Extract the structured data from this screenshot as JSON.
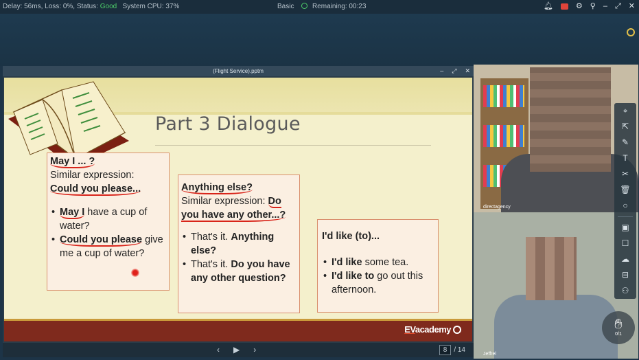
{
  "topbar": {
    "stats_prefix": "Delay: 56ms, Loss: 0%, Status:",
    "status": "Good",
    "cpu": "System CPU: 37%",
    "mode": "Basic",
    "remaining": "Remaining: 00:23"
  },
  "window": {
    "title": "(Flight Service).pptm"
  },
  "slide": {
    "title": "Part 3 Dialogue",
    "box1": {
      "heading": "May I ... ?",
      "similar": "Similar expression:",
      "expression": "Could you please...",
      "bullet1_bold": "May I",
      "bullet1_rest": " have a cup of water?",
      "bullet2_bold": "Could you please",
      "bullet2_rest": " give me a cup of water?"
    },
    "box2": {
      "heading": "Anything else?",
      "similar": "Similar expression: ",
      "expression": "Do you have any other...?",
      "bullet1_plain": "That's it. ",
      "bullet1_bold": "Anything else?",
      "bullet2_plain": "That's it. ",
      "bullet2_bold": "Do you have any other question?"
    },
    "box3": {
      "heading": "I'd like (to)...",
      "bullet1_bold": "I'd like",
      "bullet1_rest": " some tea.",
      "bullet2_bold": "I'd like to",
      "bullet2_rest": " go out this afternoon."
    },
    "logo_ev": "EV",
    "logo_rest": "academy"
  },
  "nav": {
    "current_page": "8",
    "total_pages": "/ 14"
  },
  "video": {
    "tile1_name": "directagency",
    "tile2_name": "Jeffrel",
    "raise_count": "0/1"
  }
}
